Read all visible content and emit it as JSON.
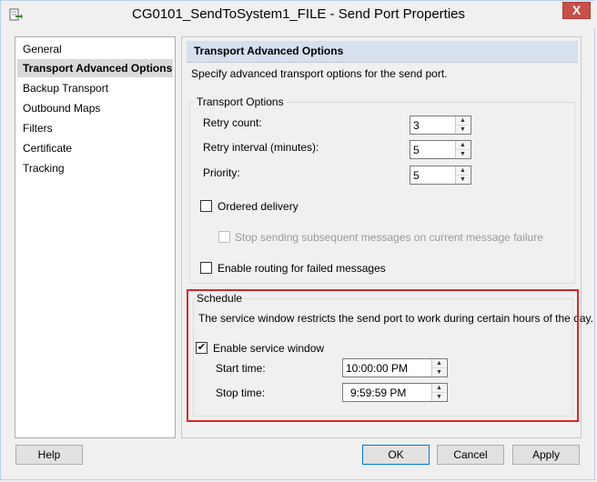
{
  "window": {
    "title": "CG0101_SendToSystem1_FILE - Send Port Properties",
    "close_label": "X",
    "icon": "send-port-icon"
  },
  "nav": {
    "items": [
      {
        "label": "General"
      },
      {
        "label": "Transport Advanced Options",
        "selected": true
      },
      {
        "label": "Backup Transport"
      },
      {
        "label": "Outbound Maps"
      },
      {
        "label": "Filters"
      },
      {
        "label": "Certificate"
      },
      {
        "label": "Tracking"
      }
    ]
  },
  "main": {
    "header": "Transport Advanced Options",
    "description": "Specify advanced transport options for the send port.",
    "transport_options": {
      "title": "Transport Options",
      "retry_count_label": "Retry count:",
      "retry_count_value": "3",
      "retry_interval_label": "Retry interval (minutes):",
      "retry_interval_value": "5",
      "priority_label": "Priority:",
      "priority_value": "5",
      "ordered_delivery_label": "Ordered delivery",
      "ordered_delivery_checked": false,
      "stop_sending_label": "Stop sending subsequent messages on current message failure",
      "stop_sending_checked": false,
      "enable_routing_label": "Enable routing for failed messages",
      "enable_routing_checked": false
    },
    "schedule": {
      "title": "Schedule",
      "description": "The service window restricts the send port to work during certain hours of the day.",
      "enable_service_window_label": "Enable service window",
      "enable_service_window_checked": true,
      "start_time_label": "Start time:",
      "start_time_value": "10:00:00 PM",
      "stop_time_label": "Stop time:",
      "stop_time_value": "9:59:59 PM"
    }
  },
  "buttons": {
    "help": "Help",
    "ok": "OK",
    "cancel": "Cancel",
    "apply": "Apply"
  },
  "colors": {
    "highlight_border": "#d9262c",
    "header_bg": "#d6e0ee",
    "close_bg": "#c7504a"
  }
}
